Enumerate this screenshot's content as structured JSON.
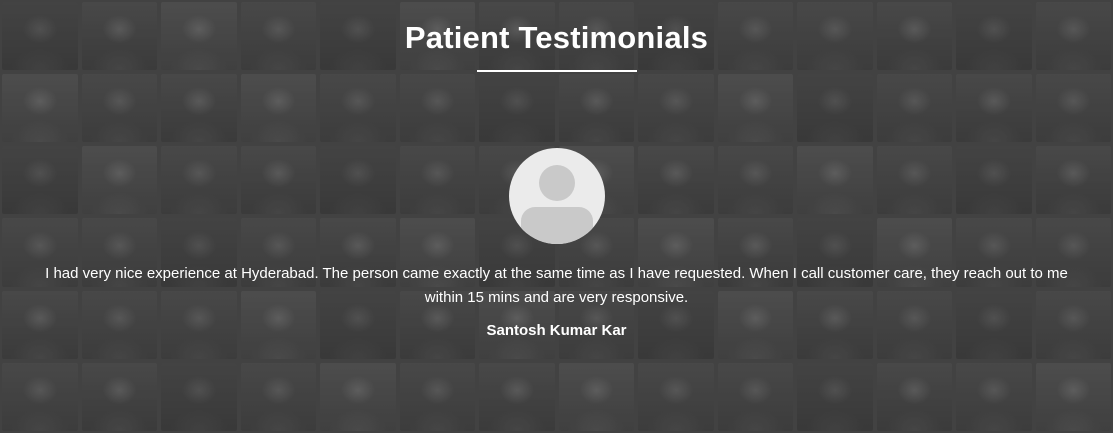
{
  "section": {
    "title": "Patient Testimonials"
  },
  "testimonial": {
    "avatar_icon": "user-avatar-placeholder-icon",
    "text": "I had very nice experience at Hyderabad. The person came exactly at the same time as I have requested. When I call customer care, they reach out to me within 15 mins and are very responsive.",
    "author": "Santosh Kumar Kar"
  },
  "colors": {
    "background": "#4a4a4a",
    "text": "#ffffff",
    "avatar_bg": "#ebebeb",
    "avatar_figure": "#c9c9c9"
  }
}
